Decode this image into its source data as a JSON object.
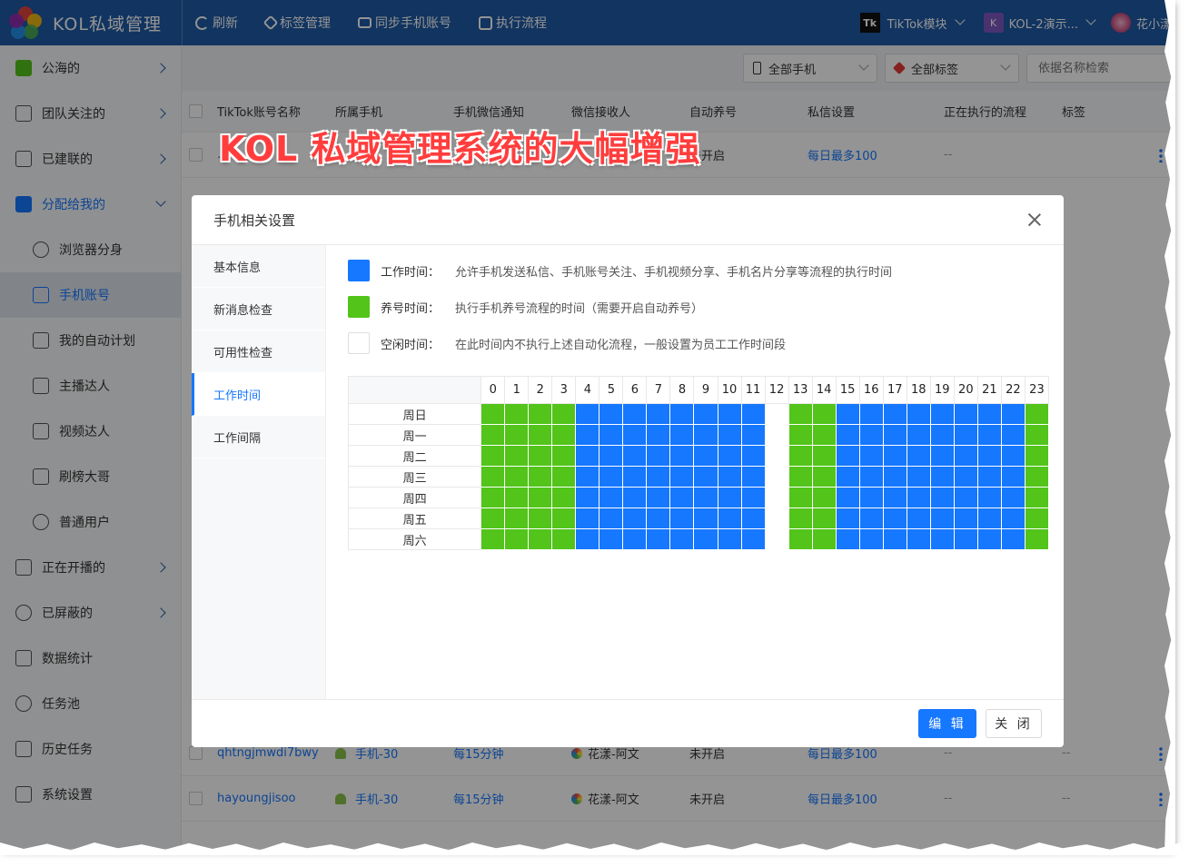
{
  "app": {
    "title": "KOL私域管理"
  },
  "topnav": [
    {
      "label": "刷新",
      "icon": "refresh-icon"
    },
    {
      "label": "标签管理",
      "icon": "tag-icon"
    },
    {
      "label": "同步手机账号",
      "icon": "sync-icon"
    },
    {
      "label": "执行流程",
      "icon": "flow-icon"
    }
  ],
  "topright": {
    "tiktok_badge": "Tk",
    "module": "TikTok模块",
    "workspace_badge": "K",
    "workspace": "KOL-2演示...",
    "user": "花小漾"
  },
  "sidebar": [
    {
      "label": "公海的",
      "icon": "public-icon",
      "arrow": true
    },
    {
      "label": "团队关注的",
      "icon": "star-icon",
      "arrow": true
    },
    {
      "label": "已建联的",
      "icon": "handshake-icon",
      "arrow": true
    },
    {
      "label": "分配给我的",
      "icon": "assigned-icon",
      "arrow": true,
      "open": true
    },
    {
      "label": "浏览器分身",
      "icon": "chrome-icon",
      "sub": true
    },
    {
      "label": "手机账号",
      "icon": "phone-icon",
      "sub": true,
      "active": true
    },
    {
      "label": "我的自动计划",
      "icon": "calendar-icon",
      "sub": true
    },
    {
      "label": "主播达人",
      "icon": "tiktok-icon",
      "sub": true
    },
    {
      "label": "视频达人",
      "icon": "video-icon",
      "sub": true
    },
    {
      "label": "刷榜大哥",
      "icon": "diamond-icon",
      "sub": true
    },
    {
      "label": "普通用户",
      "icon": "user-icon",
      "sub": true
    },
    {
      "label": "正在开播的",
      "icon": "mic-icon",
      "arrow": true
    },
    {
      "label": "已屏蔽的",
      "icon": "block-icon",
      "arrow": true
    },
    {
      "label": "数据统计",
      "icon": "chart-icon"
    },
    {
      "label": "任务池",
      "icon": "timer-icon"
    },
    {
      "label": "历史任务",
      "icon": "clipboard-icon"
    },
    {
      "label": "系统设置",
      "icon": "gear-icon"
    }
  ],
  "filters": {
    "phone_select": "全部手机",
    "tag_select": "全部标签",
    "search_placeholder": "依据名称检索"
  },
  "table": {
    "columns": [
      "TikTok账号名称",
      "所属手机",
      "手机微信通知",
      "微信接收人",
      "自动养号",
      "私信设置",
      "正在执行的流程",
      "标签"
    ],
    "rows": [
      {
        "name": "…",
        "phone": "",
        "notify": "",
        "receiver": "",
        "auto": "未开启",
        "dm": "每日最多100",
        "flow": "--",
        "tag": ""
      },
      {
        "name": "qhtngjmwdi7bwy",
        "phone": "手机-30",
        "notify": "每15分钟",
        "receiver": "花漾-阿文",
        "auto": "未开启",
        "dm": "每日最多100",
        "flow": "--",
        "tag": "--"
      },
      {
        "name": "hayoungjisoo",
        "phone": "手机-30",
        "notify": "每15分钟",
        "receiver": "花漾-阿文",
        "auto": "未开启",
        "dm": "每日最多100",
        "flow": "--",
        "tag": "--"
      }
    ]
  },
  "banner": "KOL 私域管理系统的大幅增强",
  "modal": {
    "title": "手机相关设置",
    "tabs": [
      "基本信息",
      "新消息检查",
      "可用性检查",
      "工作时间",
      "工作间隔"
    ],
    "active_tab": 3,
    "legend": [
      {
        "key": "work",
        "label": "工作时间：",
        "desc": "允许手机发送私信、手机账号关注、手机视频分享、手机名片分享等流程的执行时间",
        "color": "#1677ff"
      },
      {
        "key": "nurture",
        "label": "养号时间：",
        "desc": "执行手机养号流程的时间（需要开启自动养号）",
        "color": "#52c41a"
      },
      {
        "key": "idle",
        "label": "空闲时间：",
        "desc": "在此时间内不执行上述自动化流程，一般设置为员工工作时间段",
        "color": "#ffffff"
      }
    ],
    "hours": [
      "0",
      "1",
      "2",
      "3",
      "4",
      "5",
      "6",
      "7",
      "8",
      "9",
      "10",
      "11",
      "12",
      "13",
      "14",
      "15",
      "16",
      "17",
      "18",
      "19",
      "20",
      "21",
      "22",
      "23"
    ],
    "days": [
      "周日",
      "周一",
      "周二",
      "周三",
      "周四",
      "周五",
      "周六"
    ],
    "hour_modes": [
      "nurture",
      "nurture",
      "nurture",
      "nurture",
      "work",
      "work",
      "work",
      "work",
      "work",
      "work",
      "work",
      "work",
      "idle",
      "nurture",
      "nurture",
      "work",
      "work",
      "work",
      "work",
      "work",
      "work",
      "work",
      "work",
      "nurture"
    ],
    "edit_button": "编 辑",
    "close_button": "关 闭"
  }
}
